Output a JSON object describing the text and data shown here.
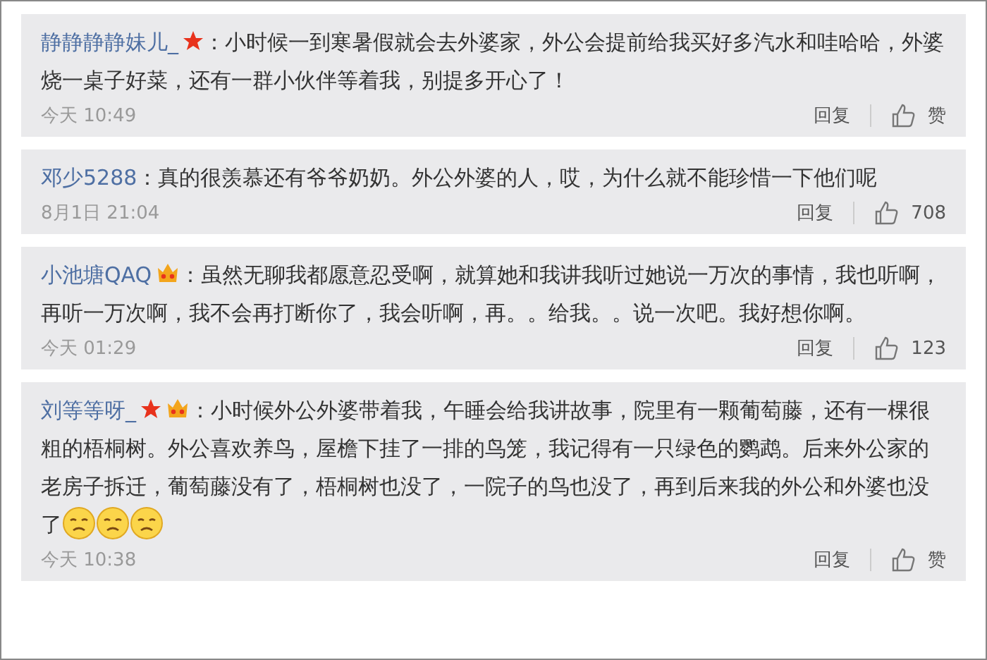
{
  "comments": [
    {
      "user": "静静静静妹儿_",
      "badges": [
        {
          "kind": "star"
        }
      ],
      "text": "：小时候一到寒暑假就会去外婆家，外公会提前给我买好多汽水和哇哈哈，外婆烧一桌子好菜，还有一群小伙伴等着我，别提多开心了！",
      "time": "今天 10:49",
      "reply": "回复",
      "likes": "赞"
    },
    {
      "user": "邓少5288",
      "text": "：真的很羡慕还有爷爷奶奶。外公外婆的人，哎，为什么就不能珍惜一下他们呢",
      "time": "8月1日 21:04",
      "reply": "回复",
      "likes": "708"
    },
    {
      "user": "小池塘QAQ",
      "badges": [
        {
          "kind": "crown"
        }
      ],
      "text": "：虽然无聊我都愿意忍受啊，就算她和我讲我听过她说一万次的事情，我也听啊，再听一万次啊，我不会再打断你了，我会听啊，再。。给我。。说一次吧。我好想你啊。",
      "time": "今天 01:29",
      "reply": "回复",
      "likes": "123"
    },
    {
      "user": "刘等等呀_",
      "badges": [
        {
          "kind": "star"
        },
        {
          "kind": "crown"
        }
      ],
      "text": "：小时候外公外婆带着我，午睡会给我讲故事，院里有一颗葡萄藤，还有一棵很粗的梧桐树。外公喜欢养鸟，屋檐下挂了一排的鸟笼，我记得有一只绿色的鹦鹉。后来外公家的老房子拆迁，葡萄藤没有了，梧桐树也没了，一院子的鸟也没了，再到后来我的外公和外婆也没了",
      "emojis": [
        {
          "kind": "sad-face"
        },
        {
          "kind": "sad-face"
        },
        {
          "kind": "sad-face"
        }
      ],
      "time": "今天 10:38",
      "reply": "回复",
      "likes": "赞"
    }
  ]
}
